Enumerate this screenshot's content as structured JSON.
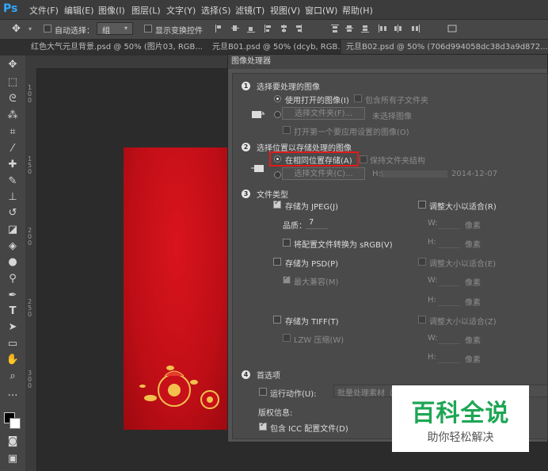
{
  "app": {
    "logo": "Ps"
  },
  "menu": [
    "文件(F)",
    "编辑(E)",
    "图像(I)",
    "图层(L)",
    "文字(Y)",
    "选择(S)",
    "滤镜(T)",
    "视图(V)",
    "窗口(W)",
    "帮助(H)"
  ],
  "options": {
    "auto_select_label": "自动选择：",
    "auto_select_value": "组",
    "show_transform_label": "显示变换控件"
  },
  "tabs": [
    "红色大气元旦背景.psd @ 50% (图片03, RGB...",
    "元旦B01.psd @ 50% (dcyb, RGB...",
    "元旦B02.psd @ 50% (706d994058dc38d3a9d872..."
  ],
  "ruler": {
    "left_ticks": [
      "1",
      "0",
      "0",
      "1",
      "5",
      "0",
      "2",
      "0",
      "0",
      "2",
      "5",
      "0",
      "3",
      "0",
      "0"
    ]
  },
  "dialog": {
    "title": "图像处理器",
    "section1": {
      "num": "1",
      "title": "选择要处理的图像",
      "use_open": "使用打开的图像(I)",
      "include_sub": "包含所有子文件夹",
      "select_folder_btn": "选择文件夹(F)...",
      "no_image": "未选择图像",
      "open_first": "打开第一个要应用设置的图像(O)"
    },
    "section2": {
      "num": "2",
      "title": "选择位置以存储处理的图像",
      "same_location": "在相同位置存储(A)",
      "keep_structure": "保持文件夹结构",
      "select_folder_btn": "选择文件夹(C)...",
      "path": "H:\\",
      "date": "2014-12-07"
    },
    "section3": {
      "num": "3",
      "title": "文件类型",
      "jpeg": "存储为 JPEG(J)",
      "resize1": "调整大小以适合(R)",
      "quality_label": "品质：",
      "quality_value": "7",
      "w_label": "W:",
      "h_label": "H:",
      "px": "像素",
      "srgb": "将配置文件转换为 sRGB(V)",
      "psd": "存储为 PSD(P)",
      "resize2": "调整大小以适合(E)",
      "max_compat": "最大兼容(M)",
      "tiff": "存储为 TIFF(T)",
      "resize3": "调整大小以适合(Z)",
      "lzw": "LZW 压缩(W)"
    },
    "section4": {
      "num": "4",
      "title": "首选项",
      "run_action": "运行动作(U):",
      "action_set": "批量处理素材（",
      "copyright": "版权信息:",
      "icc": "包含 ICC 配置文件(D)"
    }
  },
  "watermark": {
    "main": "百科全说",
    "sub": "助你轻松解决"
  }
}
